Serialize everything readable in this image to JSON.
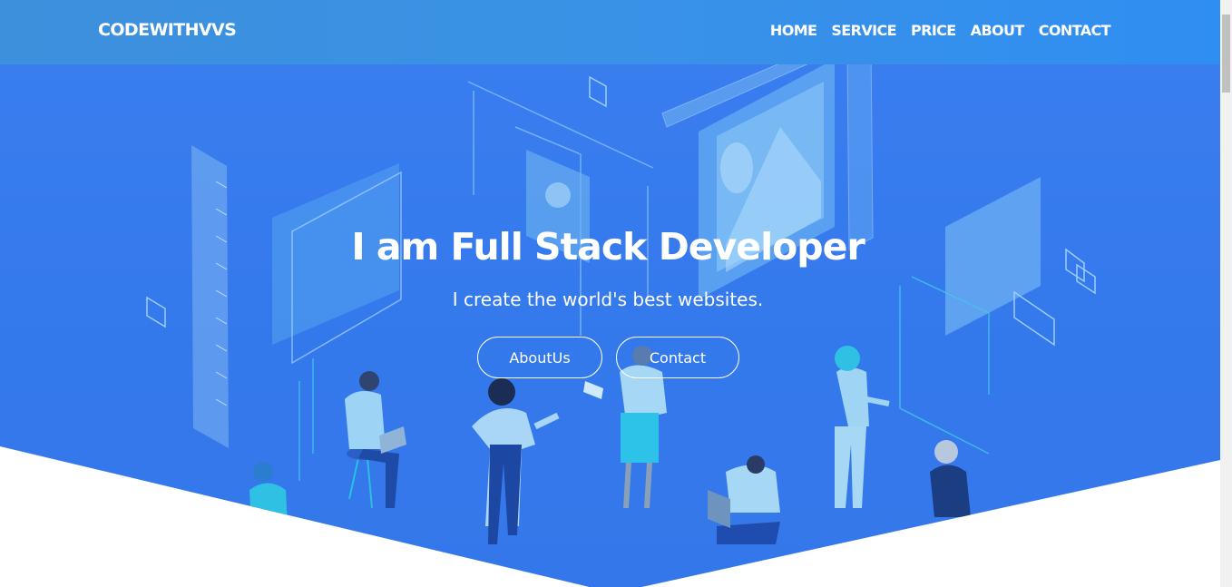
{
  "navbar": {
    "brand": "CODEWITHVVS",
    "links": [
      "HOME",
      "SERVICE",
      "PRICE",
      "ABOUT",
      "CONTACT"
    ]
  },
  "hero": {
    "headline": "I am Full Stack Developer",
    "subline": "I create the world's best websites.",
    "buttons": {
      "about": "AboutUs",
      "contact": "Contact"
    }
  },
  "colors": {
    "hero_bg": "#3479ec",
    "navbar_bg": "#3a92e6",
    "text": "#ffffff"
  },
  "icons": [
    "isometric-developers-illustration"
  ]
}
